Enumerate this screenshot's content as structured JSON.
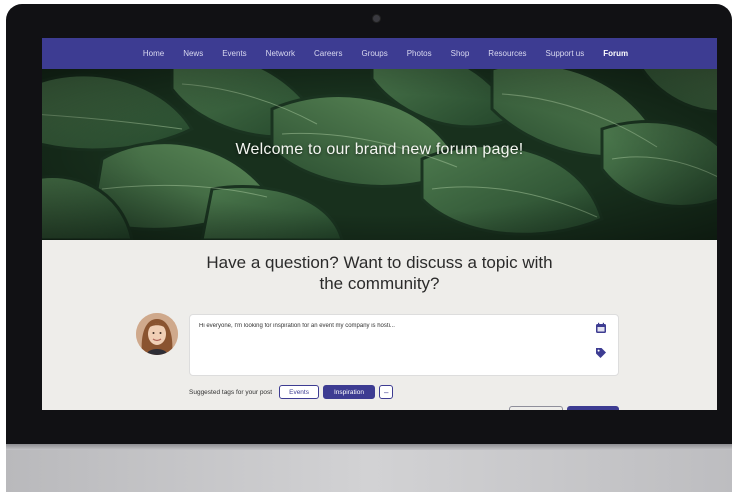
{
  "navbar": {
    "items": [
      {
        "label": "Home"
      },
      {
        "label": "News"
      },
      {
        "label": "Events"
      },
      {
        "label": "Network"
      },
      {
        "label": "Careers"
      },
      {
        "label": "Groups"
      },
      {
        "label": "Photos"
      },
      {
        "label": "Shop"
      },
      {
        "label": "Resources"
      },
      {
        "label": "Support us"
      },
      {
        "label": "Forum"
      }
    ],
    "active": "Forum"
  },
  "hero": {
    "title": "Welcome to our brand new forum page!"
  },
  "main": {
    "question_line1": "Have a question? Want to discuss a topic with",
    "question_line2": "the community?",
    "post_text": "Hi everyone, I'm looking for inspiration for an event my company is hosti...",
    "post_icons": [
      "calendar-icon",
      "tag-icon"
    ],
    "tags_label": "Suggested tags for your post",
    "tags": [
      {
        "label": "Events",
        "style": "outline"
      },
      {
        "label": "Inspiration",
        "style": "filled"
      }
    ],
    "more_tags_label": "–"
  },
  "colors": {
    "brand": "#3d3c92",
    "page_bg": "#eeedea",
    "bezel": "#111114"
  }
}
